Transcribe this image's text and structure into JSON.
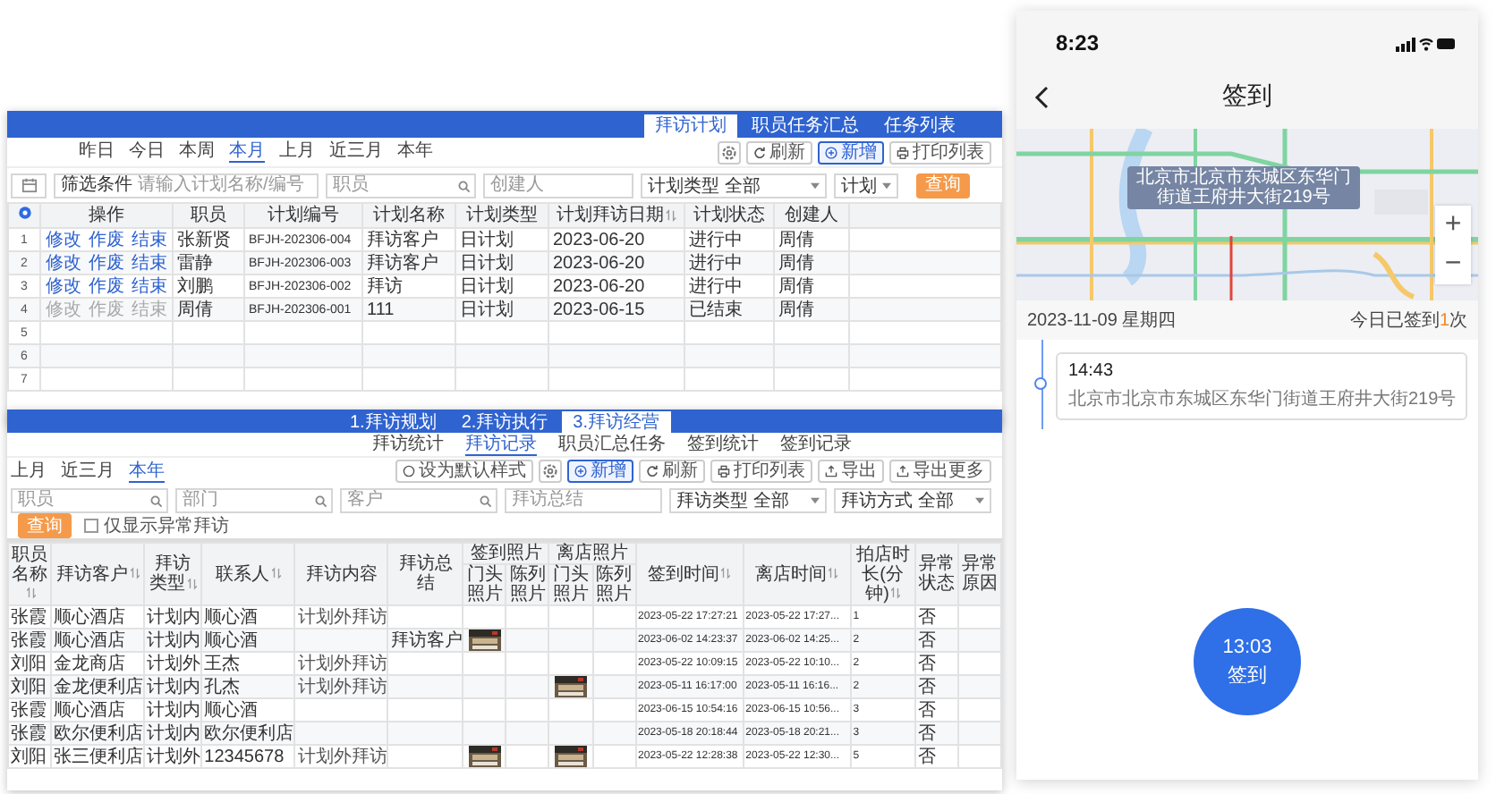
{
  "plan_window": {
    "tabs": [
      {
        "label": "拜访计划",
        "selected": true
      },
      {
        "label": "职员任务汇总",
        "selected": false
      },
      {
        "label": "任务列表",
        "selected": false
      }
    ],
    "periods": [
      {
        "label": "昨日",
        "selected": false
      },
      {
        "label": "今日",
        "selected": false
      },
      {
        "label": "本周",
        "selected": false
      },
      {
        "label": "本月",
        "selected": true
      },
      {
        "label": "上月",
        "selected": false
      },
      {
        "label": "近三月",
        "selected": false
      },
      {
        "label": "本年",
        "selected": false
      }
    ],
    "toolbar": [
      {
        "kind": "settings"
      },
      {
        "kind": "refresh",
        "label": "刷新",
        "selected": false
      },
      {
        "kind": "add",
        "label": "新增",
        "selected": true
      },
      {
        "kind": "print",
        "label": "打印列表",
        "selected": false
      }
    ],
    "filters": [
      {
        "kind": "date"
      },
      {
        "kind": "text",
        "label": "筛选条件",
        "placeholder": "请输入计划名称/编号"
      },
      {
        "kind": "search",
        "placeholder": "职员"
      },
      {
        "kind": "text",
        "placeholder": "创建人"
      },
      {
        "kind": "select",
        "label": "计划类型",
        "value": "全部"
      },
      {
        "kind": "select",
        "value": "计划"
      },
      {
        "kind": "query",
        "label": "查询"
      }
    ],
    "table": {
      "columns": [
        {
          "kind": "settings",
          "sortable": false
        },
        {
          "label": "操作",
          "sortable": false
        },
        {
          "label": "职员",
          "sortable": false
        },
        {
          "label": "计划编号",
          "sortable": false
        },
        {
          "label": "计划名称",
          "sortable": false
        },
        {
          "label": "计划类型",
          "sortable": false
        },
        {
          "label": "计划拜访日期",
          "sortable": true
        },
        {
          "label": "计划状态",
          "sortable": false
        },
        {
          "label": "创建人",
          "sortable": false
        }
      ],
      "rows": [
        {
          "index": "1",
          "disabled": false,
          "actions": [
            "修改",
            "作废",
            "结束"
          ],
          "cells": [
            "张新贤",
            "BFJH-202306-004",
            "拜访客户",
            "日计划",
            "2023-06-20",
            "进行中",
            "周倩"
          ]
        },
        {
          "index": "2",
          "disabled": false,
          "actions": [
            "修改",
            "作废",
            "结束"
          ],
          "cells": [
            "雷静",
            "BFJH-202306-003",
            "拜访客户",
            "日计划",
            "2023-06-20",
            "进行中",
            "周倩"
          ]
        },
        {
          "index": "3",
          "disabled": false,
          "actions": [
            "修改",
            "作废",
            "结束"
          ],
          "cells": [
            "刘鹏",
            "BFJH-202306-002",
            "拜访",
            "日计划",
            "2023-06-20",
            "进行中",
            "周倩"
          ]
        },
        {
          "index": "4",
          "disabled": true,
          "actions": [
            "修改",
            "作废",
            "结束"
          ],
          "cells": [
            "周倩",
            "BFJH-202306-001",
            "111",
            "日计划",
            "2023-06-15",
            "已结束",
            "周倩"
          ]
        },
        {
          "index": "5"
        },
        {
          "index": "6"
        },
        {
          "index": "7"
        }
      ]
    }
  },
  "visit_window": {
    "tabs": [
      {
        "label": "1.拜访规划",
        "selected": false
      },
      {
        "label": "2.拜访执行",
        "selected": false
      },
      {
        "label": "3.拜访经营",
        "selected": true
      }
    ],
    "subtabs": [
      {
        "label": "拜访统计",
        "selected": false
      },
      {
        "label": "拜访记录",
        "selected": true
      },
      {
        "label": "职员汇总任务",
        "selected": false
      },
      {
        "label": "签到统计",
        "selected": false
      },
      {
        "label": "签到记录",
        "selected": false
      }
    ],
    "periods": [
      {
        "label": "上月",
        "selected": false
      },
      {
        "label": "近三月",
        "selected": false
      },
      {
        "label": "本年",
        "selected": true
      }
    ],
    "toolbar": [
      {
        "kind": "style",
        "label": "设为默认样式",
        "selected": false
      },
      {
        "kind": "settings"
      },
      {
        "kind": "add",
        "label": "新增",
        "selected": true
      },
      {
        "kind": "refresh",
        "label": "刷新",
        "selected": false
      },
      {
        "kind": "print",
        "label": "打印列表",
        "selected": false
      },
      {
        "kind": "export",
        "label": "导出",
        "selected": false
      },
      {
        "kind": "export",
        "label": "导出更多",
        "selected": false
      }
    ],
    "filters": [
      {
        "kind": "search",
        "placeholder": "职员"
      },
      {
        "kind": "search",
        "placeholder": "部门"
      },
      {
        "kind": "search",
        "placeholder": "客户"
      },
      {
        "kind": "text",
        "placeholder": "拜访总结"
      },
      {
        "kind": "select",
        "label": "拜访类型",
        "value": "全部"
      },
      {
        "kind": "select",
        "label": "拜访方式",
        "value": "全部"
      }
    ],
    "query": "查询",
    "abnormal_only": {
      "label": "仅显示异常拜访",
      "checked": false
    },
    "table": {
      "columns": [
        {
          "label": "职员名称",
          "sortable": true
        },
        {
          "label": "拜访客户",
          "sortable": true
        },
        {
          "label": "拜访类型",
          "sortable": true
        },
        {
          "label": "联系人",
          "sortable": true
        },
        {
          "label": "拜访内容",
          "sortable": false
        },
        {
          "label": "拜访总结",
          "sortable": false
        },
        {
          "kind": "sub",
          "group": "签到照片",
          "label": "门头照片"
        },
        {
          "kind": "sub",
          "label": "陈列照片"
        },
        {
          "kind": "sub",
          "group": "离店照片",
          "label": "门头照片"
        },
        {
          "kind": "sub",
          "label": "陈列照片"
        },
        {
          "label": "签到时间",
          "sortable": true
        },
        {
          "label": "离店时间",
          "sortable": true
        },
        {
          "label": "拍店时长(分钟)",
          "sortable": true
        },
        {
          "label": "异常状态",
          "sortable": false
        },
        {
          "label": "异常原因",
          "sortable": false
        }
      ],
      "rows": [
        {
          "cells": [
            "张霞",
            "顺心酒店",
            "计划内",
            "顺心酒",
            "计划外拜访",
            null,
            null,
            null,
            null,
            null,
            "2023-05-22 17:27:21",
            "2023-05-22 17:27...",
            "1",
            "否",
            null
          ]
        },
        {
          "cells": [
            "张霞",
            "顺心酒店",
            "计划内",
            "顺心酒",
            null,
            "拜访客户",
            {
              "kind": "picture"
            },
            null,
            null,
            null,
            "2023-06-02 14:23:37",
            "2023-06-02 14:25...",
            "2",
            "否",
            null
          ]
        },
        {
          "cells": [
            "刘阳",
            "金龙商店",
            "计划外",
            "王杰",
            "计划外拜访",
            null,
            null,
            null,
            null,
            null,
            "2023-05-22 10:09:15",
            "2023-05-22 10:10...",
            "2",
            "否",
            null
          ]
        },
        {
          "cells": [
            "刘阳",
            "金龙便利店",
            "计划内",
            "孔杰",
            "计划外拜访",
            null,
            null,
            null,
            {
              "kind": "picture"
            },
            null,
            "2023-05-11 16:17:00",
            "2023-05-11 16:16...",
            "2",
            "否",
            null
          ]
        },
        {
          "cells": [
            "张霞",
            "顺心酒店",
            "计划内",
            "顺心酒",
            null,
            null,
            null,
            null,
            null,
            null,
            "2023-06-15 10:54:16",
            "2023-06-15 10:56...",
            "3",
            "否",
            null
          ]
        },
        {
          "cells": [
            "张霞",
            "欧尔便利店",
            "计划内",
            "欧尔便利店",
            null,
            null,
            null,
            null,
            null,
            null,
            "2023-05-18 20:18:44",
            "2023-05-18 20:21...",
            "3",
            "否",
            null
          ]
        },
        {
          "cells": [
            "刘阳",
            "张三便利店",
            "计划外",
            "12345678",
            "计划外拜访",
            null,
            {
              "kind": "picture"
            },
            null,
            {
              "kind": "picture"
            },
            null,
            "2023-05-22 12:28:38",
            "2023-05-22 12:30...",
            "5",
            "否",
            null
          ]
        }
      ]
    }
  },
  "phone": {
    "status_bar": {
      "time": "8:23"
    },
    "title": "签到",
    "map": {
      "kind": "picture",
      "address_label": "北京市北京市东城区东华门街道王府井大街219号",
      "zoom_in": "+",
      "zoom_out": "−"
    },
    "date": "2023-11-09 星期四",
    "summary": {
      "before": "今日已签到",
      "count": "1",
      "after": "次"
    },
    "records": [
      {
        "time": "14:43",
        "address": "北京市北京市东城区东华门街道王府井大街219号"
      }
    ],
    "checkin_button": {
      "time": "13:03",
      "label": "签到"
    }
  }
}
